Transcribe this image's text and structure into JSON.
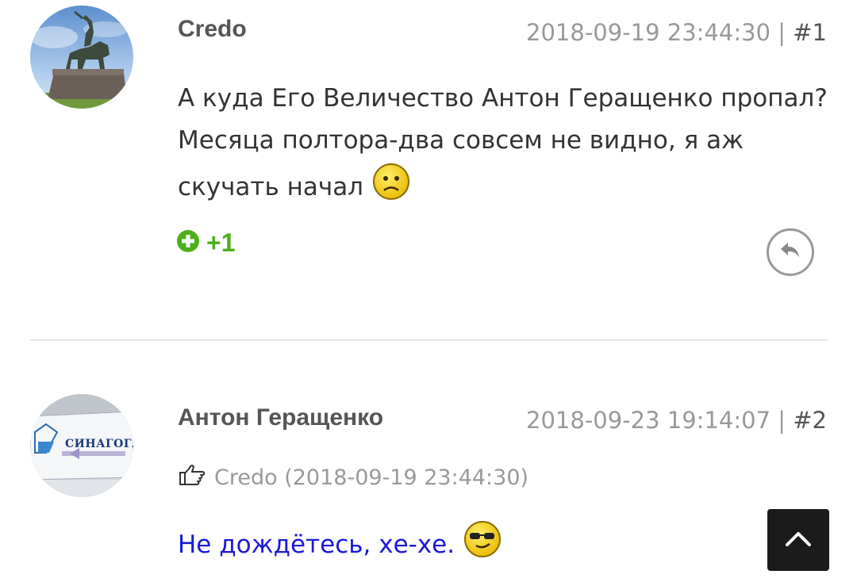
{
  "comments": [
    {
      "author": "Credo",
      "timestamp": "2018-09-19 23:44:30",
      "separator": "|",
      "number": "#1",
      "text_lines": [
        "А куда Его Величество Антон Геращенко пропал?",
        "Месяца полтора-два совсем не видно, я аж",
        "скучать начал"
      ],
      "emoji": "sad-smiley-icon",
      "vote_count": "+1",
      "avatar": "monument-avatar"
    },
    {
      "author": "Антон Геращенко",
      "timestamp": "2018-09-23 19:14:07",
      "separator": "|",
      "number": "#2",
      "quote": "Credo (2018-09-19 23:44:30)",
      "text": "Не дождётесь, хе-хе.",
      "emoji": "cool-smiley-icon",
      "avatar_sign_text": "СИНАГОГА"
    }
  ],
  "colors": {
    "vote_green": "#4caf1a",
    "reply_link_blue": "#1a1ad6",
    "meta_gray": "#999999",
    "scroll_top_bg": "#1b1b1b"
  }
}
